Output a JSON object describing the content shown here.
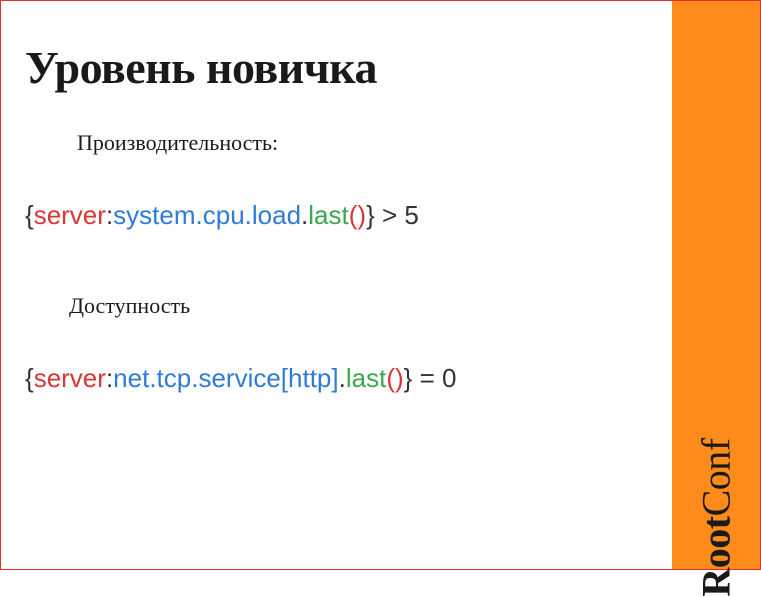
{
  "title": "Уровень новичка",
  "section1": {
    "label": "Производительность:",
    "expr": {
      "brace_open": "{",
      "server": "server",
      "colon": ":",
      "key": "system.cpu.load",
      "dot": ".",
      "func": "last",
      "paren_open": "(",
      "paren_close": ")",
      "brace_close": "}",
      "tail": " > 5"
    }
  },
  "section2": {
    "label": "Доступность",
    "expr": {
      "brace_open": "{",
      "server": "server",
      "colon": ":",
      "key": "net.tcp.service[http]",
      "dot": ".",
      "func": "last",
      "paren_open": "(",
      "paren_close": ")",
      "brace_close": "}",
      "tail": " = 0"
    }
  },
  "brand": {
    "bold": "Root",
    "light": "Conf"
  }
}
